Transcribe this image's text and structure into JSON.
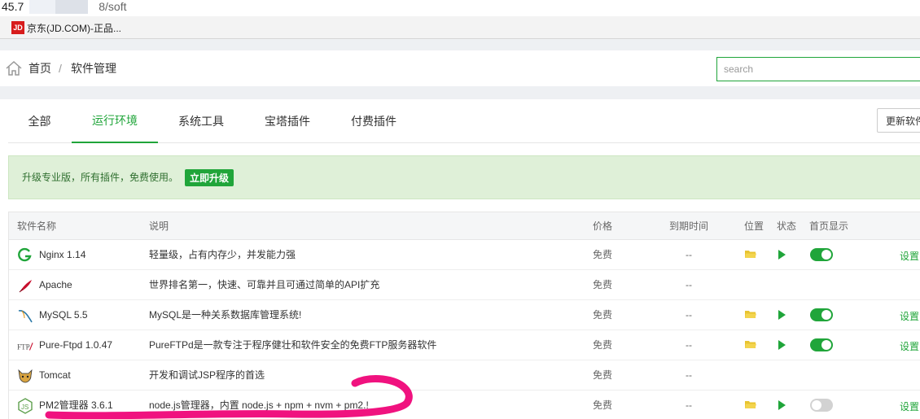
{
  "browser": {
    "url_prefix": "45.7",
    "url_suffix": "8/soft",
    "bookmark": {
      "icon": "jd-logo",
      "icon_text": "JD",
      "label": "京东(JD.COM)-正品..."
    }
  },
  "header": {
    "home_icon": "home-icon",
    "crumb_home": "首页",
    "crumb_sep": "/",
    "crumb_current": "软件管理",
    "search_placeholder": "search"
  },
  "tabs": [
    {
      "label": "全部"
    },
    {
      "label": "运行环境",
      "active": true
    },
    {
      "label": "系统工具"
    },
    {
      "label": "宝塔插件"
    },
    {
      "label": "付费插件"
    }
  ],
  "update_button": "更新软件",
  "alert": {
    "text": "升级专业版，所有插件，免费使用。",
    "button": "立即升级"
  },
  "table": {
    "headers": {
      "name": "软件名称",
      "desc": "说明",
      "price": "价格",
      "expire": "到期时间",
      "location": "位置",
      "status": "状态",
      "homepage": "首页显示"
    },
    "rows": [
      {
        "icon": "nginx-icon",
        "name": "Nginx 1.14",
        "desc": "轻量级，占有内存少，并发能力强",
        "price": "免费",
        "expire": "--",
        "installed": true,
        "homepage_on": true,
        "action": "设置"
      },
      {
        "icon": "apache-feather-icon",
        "name": "Apache",
        "desc": "世界排名第一，快速、可靠并且可通过简单的API扩充",
        "price": "免费",
        "expire": "--",
        "installed": false,
        "homepage_on": false,
        "action": ""
      },
      {
        "icon": "mysql-dolphin-icon",
        "name": "MySQL 5.5",
        "desc": "MySQL是一种关系数据库管理系统!",
        "price": "免费",
        "expire": "--",
        "installed": true,
        "homepage_on": true,
        "action": "设置"
      },
      {
        "icon": "ftp-icon",
        "name": "Pure-Ftpd 1.0.47",
        "desc": "PureFTPd是一款专注于程序健壮和软件安全的免费FTP服务器软件",
        "price": "免费",
        "expire": "--",
        "installed": true,
        "homepage_on": true,
        "action": "设置"
      },
      {
        "icon": "tomcat-icon",
        "name": "Tomcat",
        "desc": "开发和调试JSP程序的首选",
        "price": "免费",
        "expire": "--",
        "installed": false,
        "homepage_on": false,
        "action": ""
      },
      {
        "icon": "nodejs-icon",
        "name": "PM2管理器 3.6.1",
        "desc": "node.js管理器，内置 node.js + npm + nvm + pm2.!",
        "price": "免费",
        "expire": "--",
        "installed": true,
        "homepage_on": false,
        "action": "设置"
      }
    ]
  },
  "colors": {
    "accent": "#20a53a",
    "alert_bg": "#dff0d8",
    "scribble": "#f0127f",
    "folder": "#e8c430"
  }
}
